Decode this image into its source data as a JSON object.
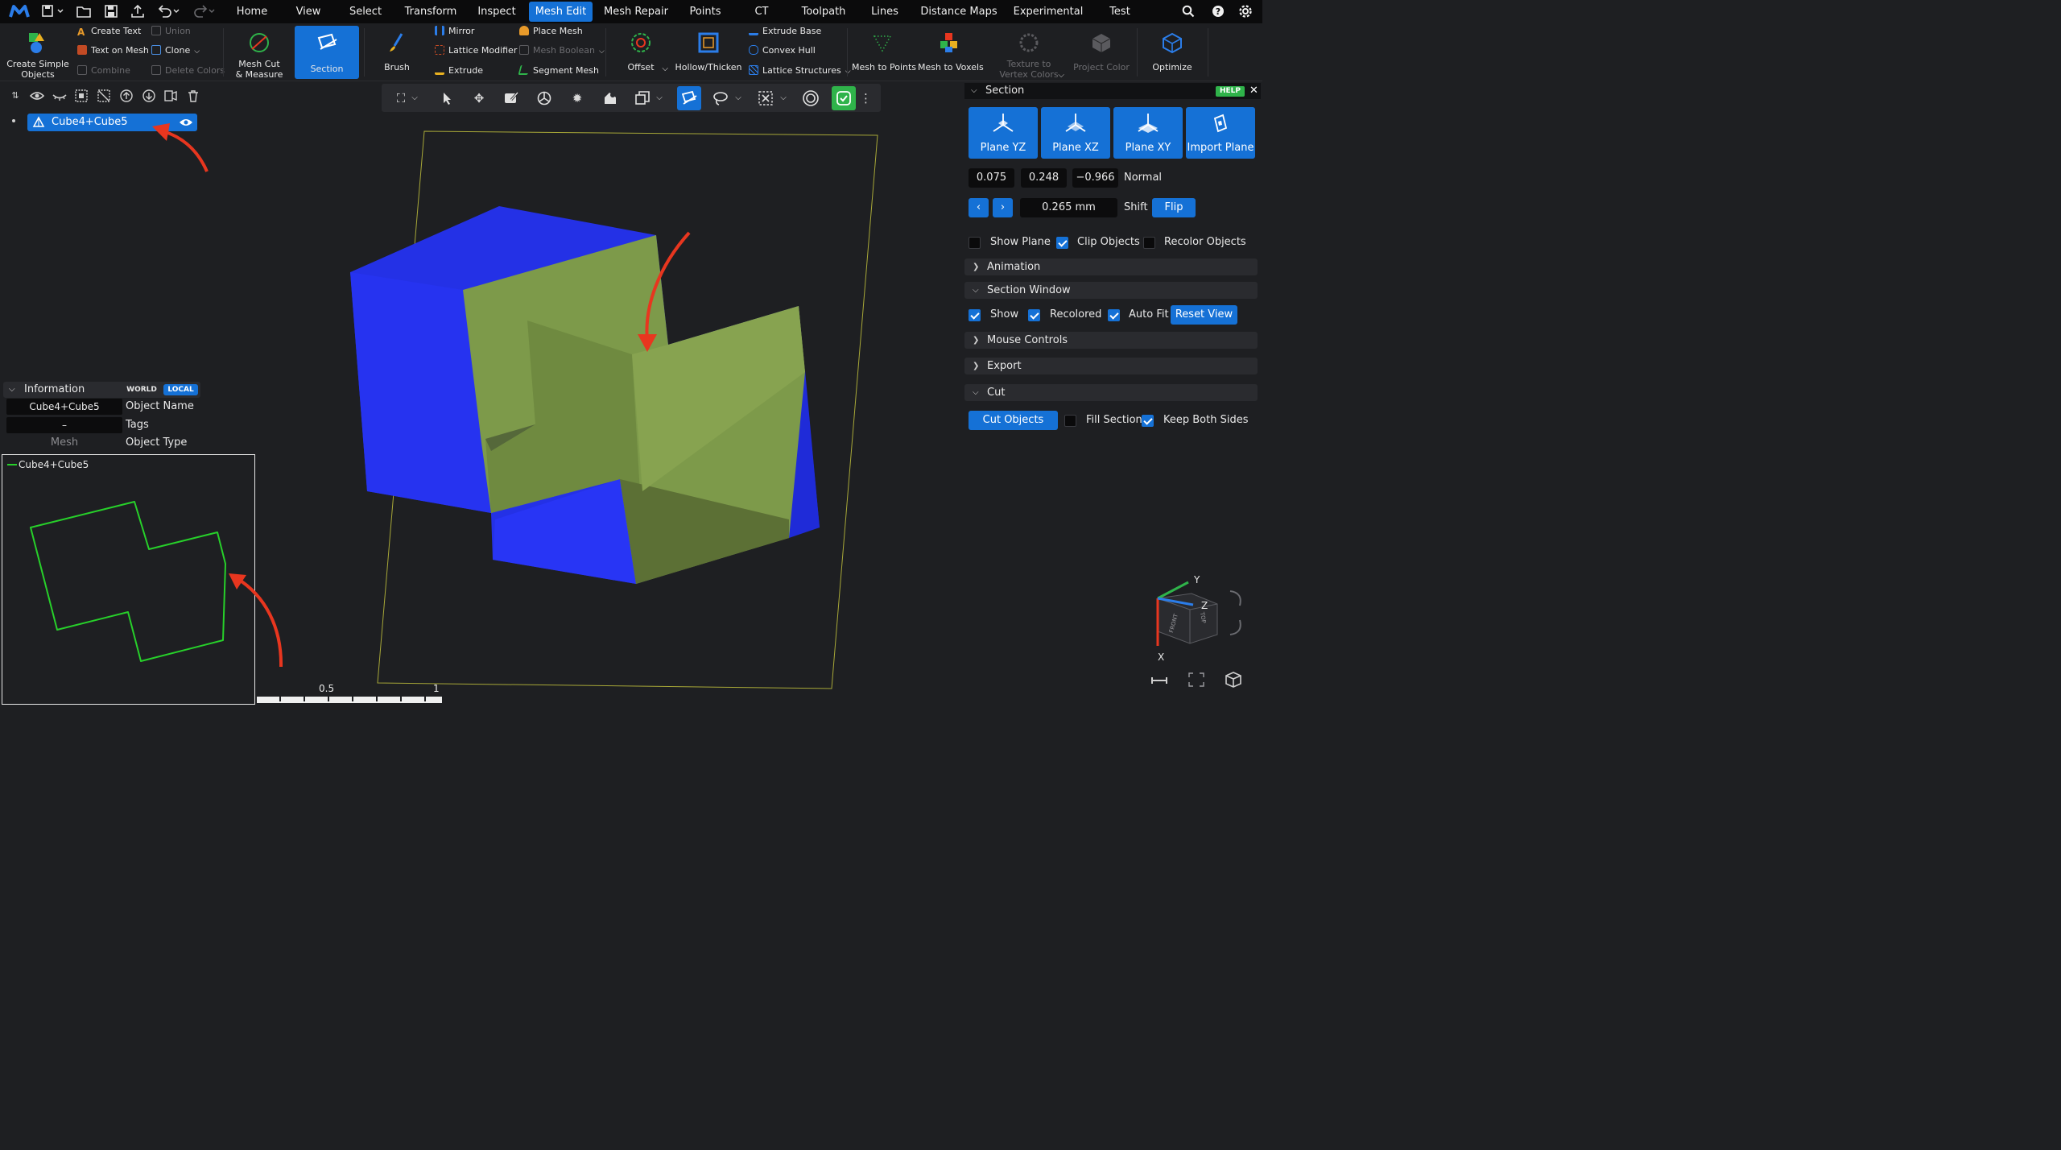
{
  "menubar": {
    "tabs": [
      "Home",
      "View",
      "Select",
      "Transform",
      "Inspect",
      "Mesh Edit",
      "Mesh Repair",
      "Points",
      "CT",
      "Toolpath",
      "Lines",
      "Distance Maps",
      "Experimental",
      "Test"
    ],
    "active_tab": "Mesh Edit"
  },
  "ribbon": {
    "create_simple_objects": "Create Simple\nObjects",
    "create_text": "Create Text",
    "text_on_mesh": "Text on Mesh",
    "combine": "Combine",
    "union": "Union",
    "clone": "Clone",
    "delete_colors": "Delete Colors",
    "mesh_cut_measure": "Mesh Cut\n& Measure",
    "section": "Section",
    "brush": "Brush",
    "mirror": "Mirror",
    "lattice_modifier": "Lattice Modifier",
    "extrude": "Extrude",
    "place_mesh": "Place Mesh",
    "mesh_boolean": "Mesh Boolean",
    "segment_mesh": "Segment Mesh",
    "offset": "Offset",
    "hollow_thicken": "Hollow/Thicken",
    "extrude_base": "Extrude Base",
    "convex_hull": "Convex Hull",
    "lattice_structures": "Lattice Structures",
    "mesh_to_points": "Mesh to Points",
    "mesh_to_voxels": "Mesh to Voxels",
    "texture_to_vertex_colors": "Texture to\nVertex Colors",
    "project_color": "Project Color",
    "optimize": "Optimize"
  },
  "scene_tree": {
    "object_name": "Cube4+Cube5"
  },
  "info": {
    "title": "Information",
    "world": "WORLD",
    "local": "LOCAL",
    "object_name_value": "Cube4+Cube5",
    "object_name_label": "Object Name",
    "tags_value": "–",
    "tags_label": "Tags",
    "type_value": "Mesh",
    "type_label": "Object Type"
  },
  "section_window": {
    "legend": "Cube4+Cube5"
  },
  "scale_bar": {
    "mid": "0.5",
    "end": "1"
  },
  "axes": {
    "y": "Y",
    "x": "X",
    "z": "Z",
    "front": "FRONT",
    "top": "TOP"
  },
  "section_panel": {
    "title": "Section",
    "help": "HELP",
    "plane_yz": "Plane YZ",
    "plane_xz": "Plane XZ",
    "plane_xy": "Plane XY",
    "import_plane": "Import Plane",
    "normal_x": "0.075",
    "normal_y": "0.248",
    "normal_z": "−0.966",
    "normal_label": "Normal",
    "shift_value": "0.265 mm",
    "shift_label": "Shift",
    "flip": "Flip",
    "show_plane": "Show Plane",
    "show_plane_checked": false,
    "clip_objects": "Clip Objects",
    "clip_objects_checked": true,
    "recolor_objects": "Recolor Objects",
    "recolor_objects_checked": false,
    "animation": "Animation",
    "section_window": "Section Window",
    "show": "Show",
    "recolored": "Recolored",
    "auto_fit": "Auto Fit",
    "reset_view": "Reset View",
    "mouse_controls": "Mouse Controls",
    "export": "Export",
    "cut": "Cut",
    "cut_objects": "Cut Objects",
    "fill_section": "Fill Section",
    "keep_both_sides": "Keep Both Sides"
  },
  "colors": {
    "accent": "#1571d6",
    "cube_blue": "#2a3be0",
    "section_green": "#7d9a4a",
    "outline_green": "#27d02a",
    "arrow_red": "#e8361f",
    "help_green": "#2fb34a"
  }
}
